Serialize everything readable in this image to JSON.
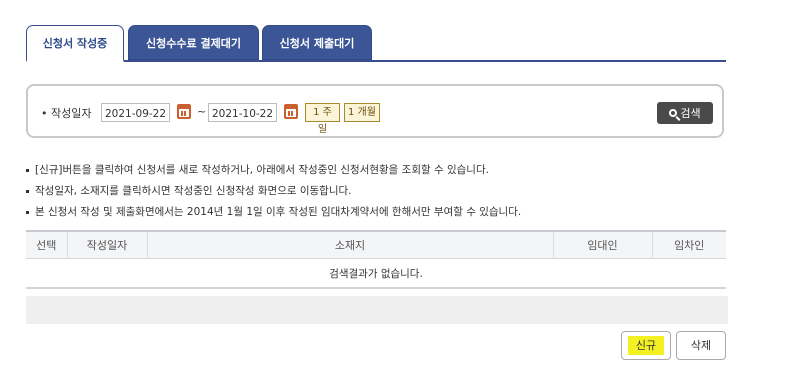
{
  "tabs": [
    {
      "label": "신청서 작성중",
      "active": true
    },
    {
      "label": "신청수수료 결제대기",
      "active": false
    },
    {
      "label": "신청서 제출대기",
      "active": false
    }
  ],
  "search": {
    "date_label": "작성일자",
    "start_date": "2021-09-22",
    "end_date": "2021-10-22",
    "tilde": "~",
    "week_button": "1 주일",
    "month_button": "1 개월",
    "search_button": "검색"
  },
  "notes": [
    "[신규]버튼을 클릭하여 신청서를 새로 작성하거나, 아래에서 작성중인 신청서현황을 조회할 수 있습니다.",
    "작성일자, 소재지를 클릭하시면 작성중인 신청작성 화면으로 이동합니다.",
    "본 신청서 작성 및 제출화면에서는 2014년 1월 1일 이후 작성된 임대차계약서에 한해서만 부여할 수 있습니다."
  ],
  "table": {
    "headers": [
      "선택",
      "작성일자",
      "소재지",
      "임대인",
      "임차인"
    ],
    "empty_message": "검색결과가 없습니다."
  },
  "buttons": {
    "new": "신규",
    "delete": "삭제"
  },
  "colors": {
    "tab_active_text": "#2f4a8a",
    "tab_inactive_bg": "#3b5596",
    "search_button_bg": "#4a4a4a",
    "highlight": "#f3f023",
    "calendar_icon": "#c8612e"
  }
}
